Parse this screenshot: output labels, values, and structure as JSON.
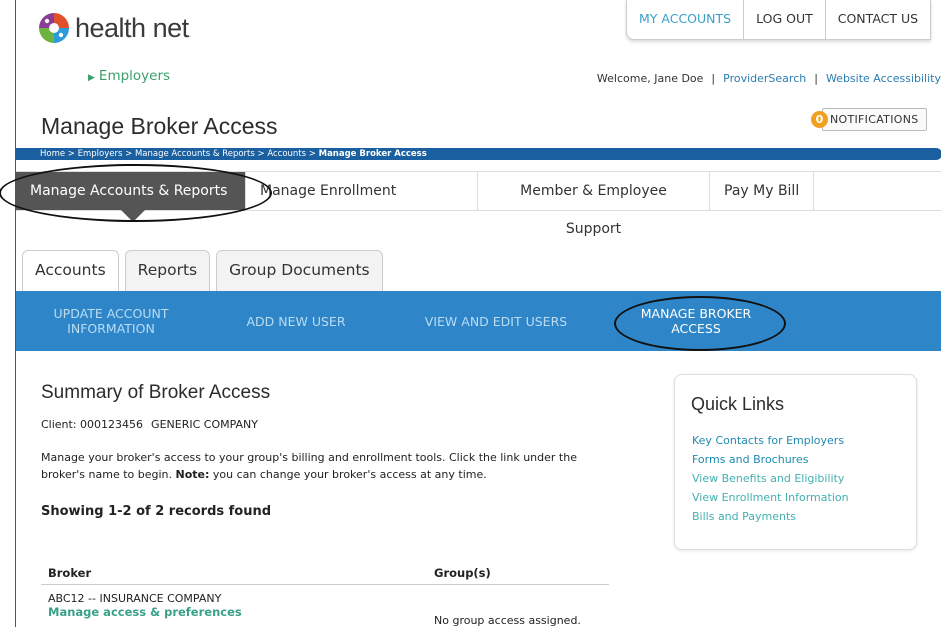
{
  "topnav": [
    "MY ACCOUNTS",
    "LOG OUT",
    "CONTACT US"
  ],
  "brand": {
    "name": "health net",
    "suffix": ".",
    "section": "Employers"
  },
  "welcome": {
    "text": "Welcome, Jane Doe",
    "links": [
      "ProviderSearch",
      "Website Accessibility"
    ]
  },
  "notifications": {
    "count": "0",
    "label": "NOTIFICATIONS"
  },
  "page_title": "Manage Broker Access",
  "breadcrumb": {
    "trail": "Home > Employers > Manage Accounts & Reports > Accounts > ",
    "current": "Manage Broker Access"
  },
  "mainnav": [
    "Manage Accounts & Reports",
    "Manage Enrollment",
    "Member & Employee Support",
    "Pay My Bill"
  ],
  "tabs": [
    "Accounts",
    "Reports",
    "Group Documents"
  ],
  "subnav": [
    "UPDATE ACCOUNT INFORMATION",
    "ADD NEW USER",
    "VIEW AND EDIT USERS",
    "MANAGE BROKER ACCESS"
  ],
  "summary": {
    "title": "Summary of Broker Access",
    "client_label": "Client: 000123456",
    "client_name": "GENERIC COMPANY",
    "desc_pre": "Manage your broker's access to your group's billing and enrollment tools. Click the link under the broker's name to begin. ",
    "desc_note_label": "Note:",
    "desc_post": " you can change your broker's access at any time.",
    "showing": "Showing 1-2 of 2 records found"
  },
  "table": {
    "headers": [
      "Broker",
      "Group(s)"
    ],
    "rows": [
      {
        "broker": "ABC12 -- INSURANCE COMPANY",
        "link": "Manage access & preferences",
        "groups": "No group access assigned."
      }
    ]
  },
  "quick_links": {
    "title": "Quick Links",
    "items": [
      "Key Contacts for Employers",
      "Forms and Brochures",
      "View Benefits and Eligibility",
      "View Enrollment Information",
      "Bills and Payments"
    ]
  },
  "colors": {
    "brand_blue": "#1a5f9f",
    "subnav_blue": "#2e86c8",
    "active_nav": "#555555",
    "link_green": "#3aa08a"
  }
}
